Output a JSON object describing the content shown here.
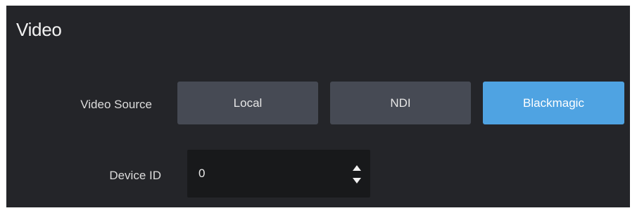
{
  "section": {
    "title": "Video"
  },
  "video_source": {
    "label": "Video Source",
    "options": [
      {
        "label": "Local",
        "selected": false
      },
      {
        "label": "NDI",
        "selected": false
      },
      {
        "label": "Blackmagic",
        "selected": true
      }
    ]
  },
  "device_id": {
    "label": "Device ID",
    "value": "0"
  },
  "icons": {
    "increment": "triangle-up-icon",
    "decrement": "triangle-down-icon"
  },
  "colors": {
    "panel_background": "#242529",
    "button_background": "#464a54",
    "selected_accent": "#4fa3e2",
    "input_background": "#18191b"
  }
}
